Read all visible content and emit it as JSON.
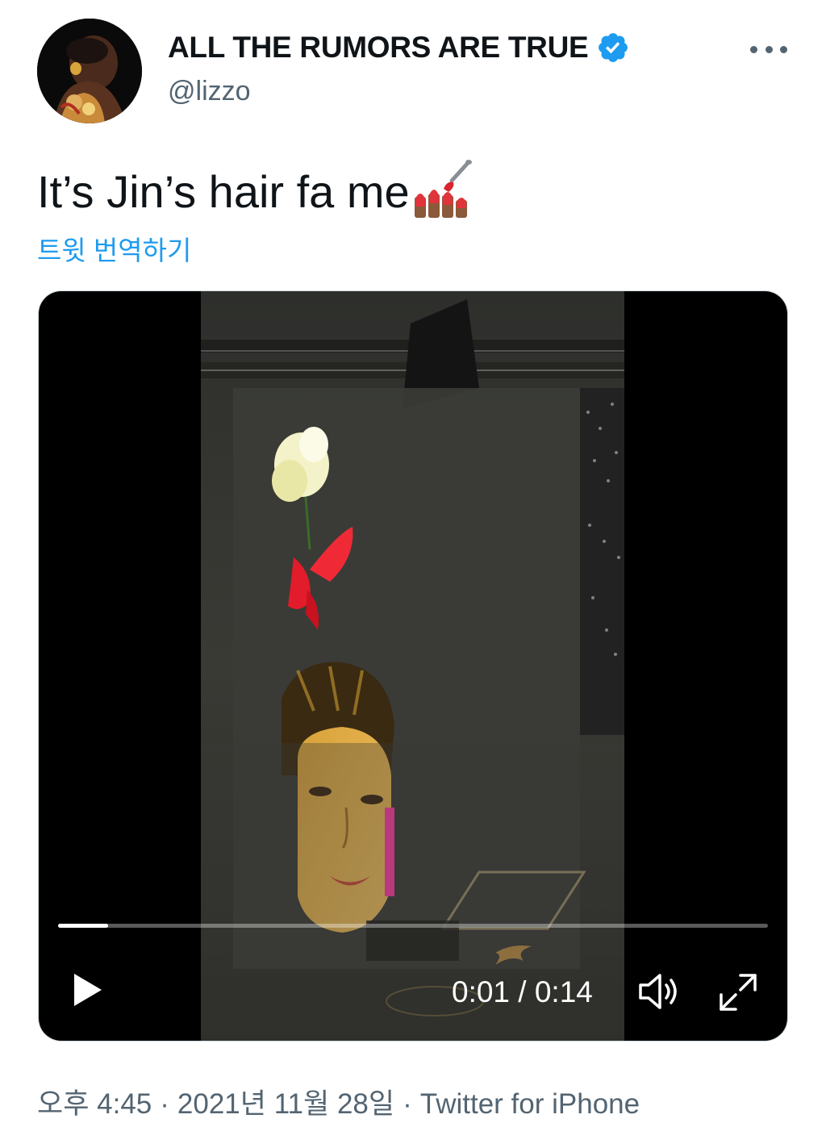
{
  "author": {
    "display_name": "ALL THE RUMORS ARE TRUE",
    "handle": "@lizzo",
    "verified": true,
    "avatar_icon": "profile-photo"
  },
  "tweet": {
    "text": "It’s Jin’s hair fa me",
    "emoji_icon": "nail-polish-icon",
    "translate_label": "트윗 번역하기"
  },
  "video": {
    "current_time": "0:01",
    "duration": "0:14",
    "time_separator": " / ",
    "progress": 0.07,
    "controls": [
      "play-icon",
      "volume-icon",
      "fullscreen-icon"
    ]
  },
  "meta": {
    "time": "오후 4:45",
    "dot1": "·",
    "date": "2021년 11월 28일",
    "dot2": "·",
    "source": "Twitter for iPhone"
  },
  "colors": {
    "link": "#1d9bf0",
    "verified": "#1d9bf0",
    "secondary_text": "#536471",
    "primary_text": "#0f1419"
  }
}
